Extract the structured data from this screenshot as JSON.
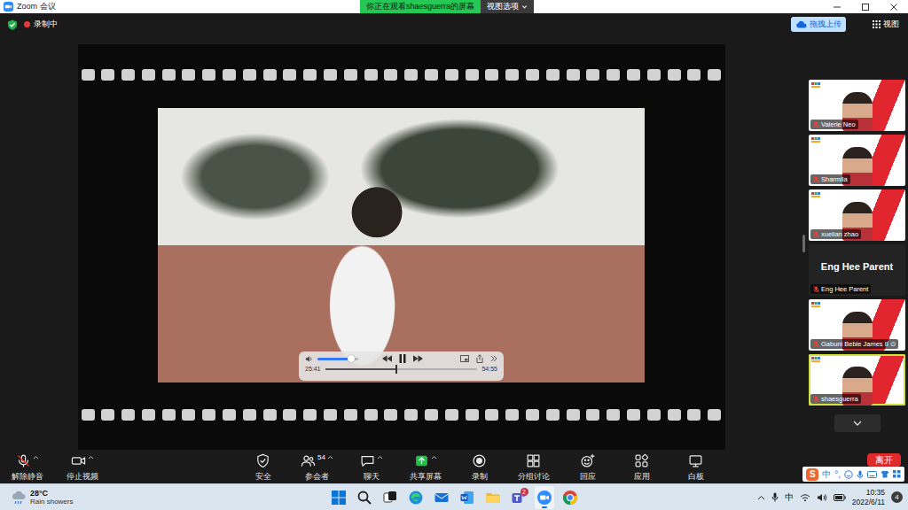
{
  "window": {
    "title": "Zoom 会议"
  },
  "banner": {
    "text": "你正在观看shaesguerra的屏幕",
    "menu": "视图选项"
  },
  "recording": {
    "label": "录制中"
  },
  "top_actions": {
    "upload": "拖拽上传",
    "view": "视图"
  },
  "shared_video": {
    "volume": 0.85,
    "playing": true,
    "elapsed": "25:41",
    "duration": "54:55",
    "progress": 0.47
  },
  "participants": [
    {
      "name": "Valerie Neo",
      "video": true,
      "muted": true,
      "active": false
    },
    {
      "name": "Sharmila",
      "video": true,
      "muted": true,
      "active": false
    },
    {
      "name": "xuelian zhao",
      "video": true,
      "muted": true,
      "active": false
    },
    {
      "name": "Eng Hee Parent",
      "video": false,
      "muted": true,
      "active": false
    },
    {
      "name": "Gabuni Bebie James II ⊙",
      "video": true,
      "muted": true,
      "active": false
    },
    {
      "name": "shaesguerra",
      "video": true,
      "muted": true,
      "active": true
    }
  ],
  "toolbar": [
    {
      "label": "解除静音",
      "menu": true,
      "badge": ""
    },
    {
      "label": "停止视频",
      "menu": true,
      "badge": ""
    },
    {
      "label": "安全",
      "menu": false,
      "badge": ""
    },
    {
      "label": "参会者",
      "menu": true,
      "badge": "54"
    },
    {
      "label": "聊天",
      "menu": true,
      "badge": ""
    },
    {
      "label": "共享屏幕",
      "menu": true,
      "badge": ""
    },
    {
      "label": "录制",
      "menu": false,
      "badge": ""
    },
    {
      "label": "分组讨论",
      "menu": false,
      "badge": ""
    },
    {
      "label": "回应",
      "menu": false,
      "badge": ""
    },
    {
      "label": "应用",
      "menu": false,
      "badge": ""
    },
    {
      "label": "白板",
      "menu": false,
      "badge": ""
    }
  ],
  "leave": {
    "label": "离开"
  },
  "ime_bar": {
    "logo": "S",
    "mode": "中",
    "punctuation": "°,"
  },
  "taskbar": {
    "weather": {
      "temp": "28°C",
      "desc": "Rain showers"
    },
    "apps": [
      {
        "badge": "",
        "running": false
      },
      {
        "badge": "",
        "running": false
      },
      {
        "badge": "",
        "running": false
      },
      {
        "badge": "",
        "running": false
      },
      {
        "badge": "",
        "running": false
      },
      {
        "badge": "",
        "running": false
      },
      {
        "badge": "",
        "running": false
      },
      {
        "badge": "2",
        "running": false
      },
      {
        "badge": "",
        "running": true
      },
      {
        "badge": "",
        "running": false
      }
    ],
    "tray": {
      "ime": "中"
    },
    "time": "10:35",
    "date": "2022/6/11",
    "notifications": "4"
  }
}
